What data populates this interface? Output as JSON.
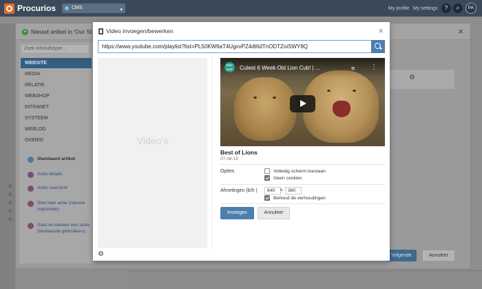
{
  "app": {
    "logo_text": "Procurios",
    "site_select": "CMS",
    "links": [
      "My profile",
      "My settings"
    ],
    "avatar_initials": "PA"
  },
  "outer_modal": {
    "title": "Nieuwt artikel in 'Our St",
    "search_placeholder": "Zoek inhoudstype...",
    "menu": [
      "WEBSITE",
      "MEDIA",
      "RELATIE",
      "WEBSHOP",
      "INTRANET",
      "SYSTEEM",
      "WEBLOG",
      "OVERIG"
    ],
    "actions": [
      "Standaard artikel",
      "Actie details",
      "Actie overzicht",
      "Start een actie (nieuwe registratie)",
      "Start en beheer een actie (bestaande gebruikers)"
    ],
    "next_label": "Volgende",
    "cancel_label": "Annuleer"
  },
  "modal": {
    "title": "Video invoegen/bewerken",
    "url_value": "https://www.youtube.com/playlist?list=PL50KW6aT4UgxvPZ4dt6dTnODTZoiSWY8Q",
    "list_placeholder": "Video's",
    "video": {
      "channel_badge": "BBC earth",
      "title": "Cutest 6 Week Old Lion Cub! | ...",
      "name": "Best of Lions",
      "date": "07-08-18"
    },
    "options": {
      "label": "Opties",
      "fullscreen_label": "Volledig scherm toestaan",
      "fullscreen_checked": false,
      "no_cookies_label": "Geen cookies",
      "no_cookies_checked": true
    },
    "dimensions": {
      "label": "Afmetingen (b/h )",
      "width": "640",
      "separator": "x",
      "height": "360",
      "keep_ratio_label": "Behoud de verhoudingen",
      "keep_ratio_checked": true
    },
    "insert_label": "Invoegen",
    "cancel_label": "Annuleer"
  }
}
